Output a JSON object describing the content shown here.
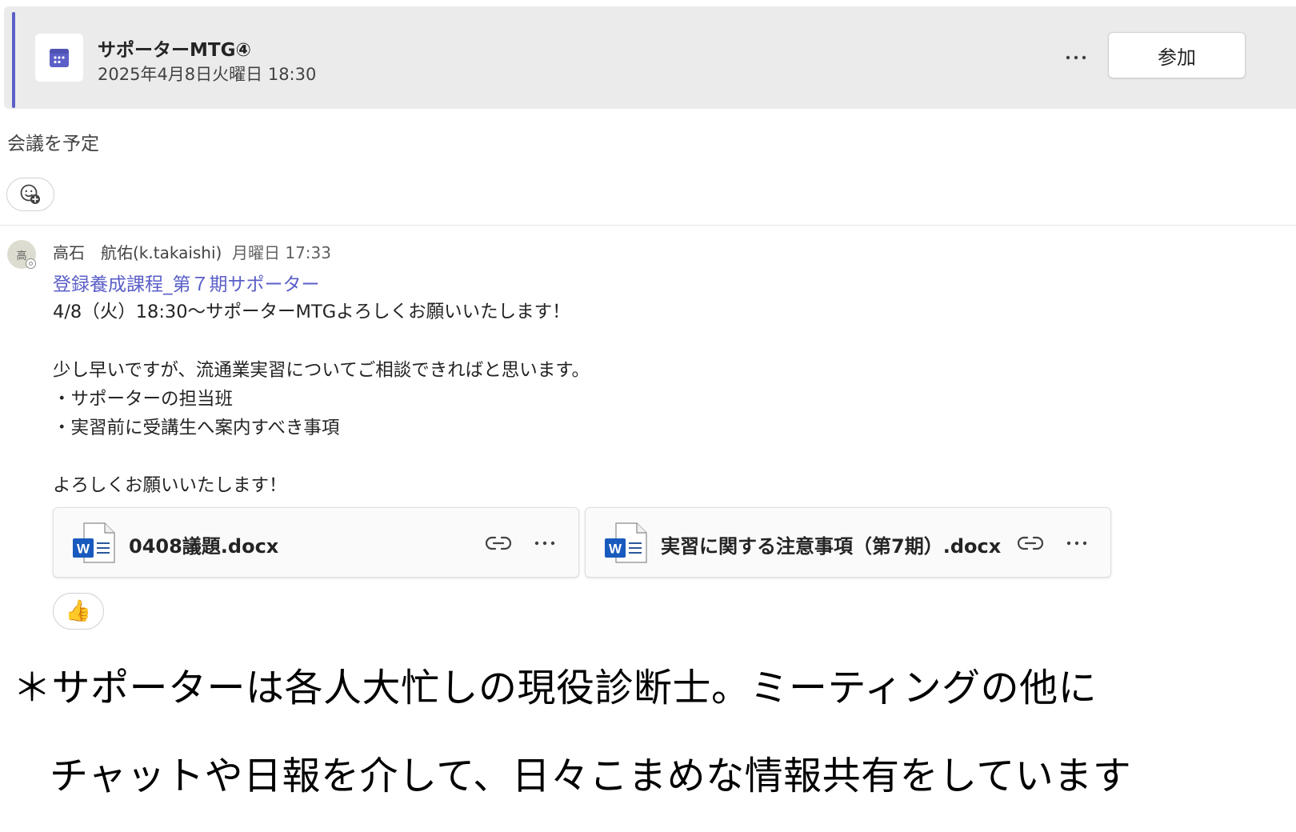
{
  "meeting": {
    "title": "サポーターMTG④",
    "datetime": "2025年4月8日火曜日 18:30",
    "join_label": "参加",
    "more_label": "···",
    "accent_color": "#5b5fc7",
    "icon": "calendar-icon"
  },
  "system_message": "会議を予定",
  "post": {
    "avatar_initial": "高",
    "sender": "高石　航佑(k.takaishi)",
    "timestamp": "月曜日 17:33",
    "channel_link": "登録養成課程_第７期サポーター",
    "lines": [
      "4/8（火）18:30～サポーターMTGよろしくお願いいたします！",
      "少し早いですが、流通業実習についてご相談できればと思います。",
      "・サポーターの担当班",
      "・実習前に受講生へ案内すべき事項",
      "よろしくお願いいたします！"
    ],
    "attachments": [
      {
        "name": "0408議題.docx",
        "icon": "word-document-icon"
      },
      {
        "name": "実習に関する注意事項（第7期）.docx",
        "icon": "word-document-icon"
      }
    ],
    "reaction": "👍"
  },
  "footer_note": {
    "line1": "＊サポーターは各人大忙しの現役診断士。ミーティングの他に",
    "line2": "チャットや日報を介して、日々こまめな情報共有をしています"
  }
}
